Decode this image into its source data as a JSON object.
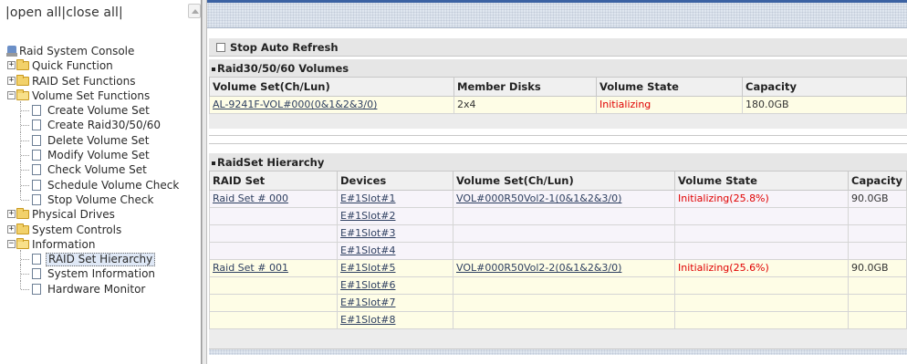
{
  "left": {
    "open_all": "open all",
    "close_all": "close all",
    "tree": {
      "root": "Raid System Console",
      "quick_function": "Quick Function",
      "raid_set_functions": "RAID Set Functions",
      "volume_set_functions": "Volume Set Functions",
      "volume_items": [
        "Create Volume Set",
        "Create Raid30/50/60",
        "Delete Volume Set",
        "Modify Volume Set",
        "Check Volume Set",
        "Schedule Volume Check",
        "Stop Volume Check"
      ],
      "physical_drives": "Physical Drives",
      "system_controls": "System Controls",
      "information": "Information",
      "information_items": [
        "RAID Set Hierarchy",
        "System Information",
        "Hardware Monitor"
      ]
    }
  },
  "right": {
    "stop_auto_refresh": "Stop Auto Refresh",
    "volumes_section": {
      "title": "Raid30/50/60 Volumes",
      "headers": [
        "Volume Set(Ch/Lun)",
        "Member Disks",
        "Volume State",
        "Capacity"
      ],
      "rows": [
        {
          "volume": "AL-9241F-VOL#000(0&1&2&3/0)",
          "members": "2x4",
          "state": "Initializing",
          "capacity": "180.0GB"
        }
      ]
    },
    "hierarchy_section": {
      "title": "RaidSet Hierarchy",
      "headers": [
        "RAID Set",
        "Devices",
        "Volume Set(Ch/Lun)",
        "Volume State",
        "Capacity"
      ],
      "rows": [
        {
          "raidset": "Raid Set # 000",
          "device": "E#1Slot#1",
          "volume": "VOL#000R50Vol2-1(0&1&2&3/0)",
          "state": "Initializing(25.8%)",
          "capacity": "90.0GB"
        },
        {
          "raidset": "",
          "device": "E#1Slot#2",
          "volume": "",
          "state": "",
          "capacity": ""
        },
        {
          "raidset": "",
          "device": "E#1Slot#3",
          "volume": "",
          "state": "",
          "capacity": ""
        },
        {
          "raidset": "",
          "device": "E#1Slot#4",
          "volume": "",
          "state": "",
          "capacity": ""
        },
        {
          "raidset": "Raid Set # 001",
          "device": "E#1Slot#5",
          "volume": "VOL#000R50Vol2-2(0&1&2&3/0)",
          "state": "Initializing(25.6%)",
          "capacity": "90.0GB"
        },
        {
          "raidset": "",
          "device": "E#1Slot#6",
          "volume": "",
          "state": "",
          "capacity": ""
        },
        {
          "raidset": "",
          "device": "E#1Slot#7",
          "volume": "",
          "state": "",
          "capacity": ""
        },
        {
          "raidset": "",
          "device": "E#1Slot#8",
          "volume": "",
          "state": "",
          "capacity": ""
        }
      ]
    }
  }
}
